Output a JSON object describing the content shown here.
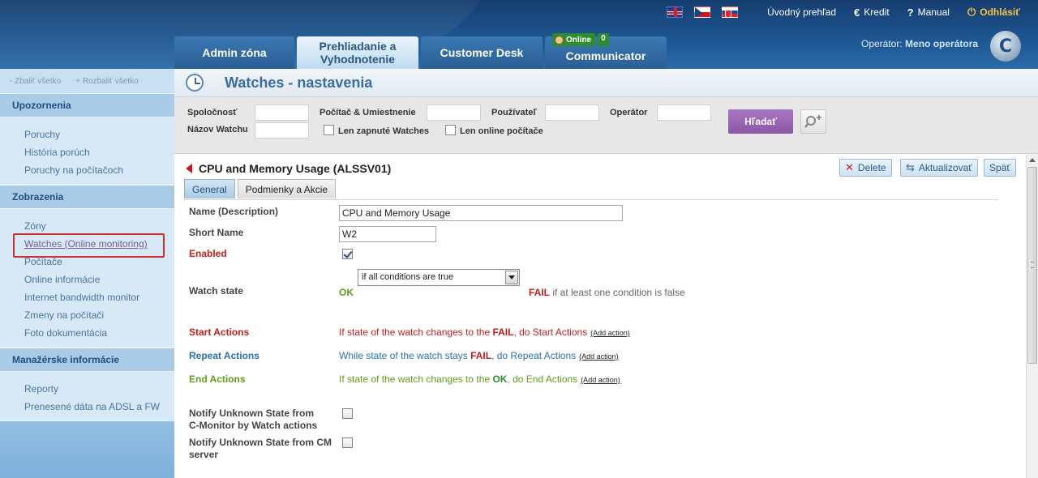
{
  "header": {
    "links": {
      "overview": "Úvodný prehľad",
      "credit": "Kredit",
      "manual": "Manual",
      "logout": "Odhlásiť"
    },
    "icons": {
      "credit": "€",
      "manual": "?",
      "logout": "⏻"
    },
    "tabs": {
      "admin": "Admin zóna",
      "review_line1": "Prehliadanie a",
      "review_line2": "Vyhodnotenie",
      "customer_desk": "Customer Desk",
      "communicator": "Communicator"
    },
    "online_badge": "Online",
    "online_count": "0",
    "operator_label": "Operátor:",
    "operator_name": "Meno operátora",
    "logo_letter": "C"
  },
  "sidebar": {
    "collapse_all": "- Zbaliť všetko",
    "expand_all": "+ Rozbaliť všetko",
    "sections": [
      {
        "title": "Upozornenia",
        "items": [
          "Poruchy",
          "História porúch",
          "Poruchy na počítačoch"
        ]
      },
      {
        "title": "Zobrazenia",
        "items": [
          "Zóny",
          "Watches (Online monitoring)",
          "Počítače",
          "Online informácie",
          "Internet bandwidth monitor",
          "Zmeny na počítači",
          "Foto dokumentácia"
        ]
      },
      {
        "title": "Manažérske informácie",
        "items": [
          "Reporty",
          "Prenesené dáta na ADSL a FW"
        ]
      }
    ]
  },
  "page": {
    "title": "Watches - nastavenia"
  },
  "filters": {
    "company": "Spoločnosť",
    "computer_location": "Počítač & Umiestnenie",
    "user": "Používateľ",
    "operator": "Operátor",
    "watch_name": "Názov Watchu",
    "only_enabled": "Len zapnuté Watches",
    "only_online": "Len online počítače",
    "search_button": "Hľadať"
  },
  "record": {
    "title": "CPU and Memory Usage (ALSSV01)",
    "buttons": {
      "delete": "Delete",
      "update": "Aktualizovať",
      "back": "Späť"
    },
    "tabs": {
      "general": "General",
      "conditions": "Podmienky a Akcie"
    },
    "fields": {
      "name_label": "Name (Description)",
      "name_value": "CPU and Memory Usage",
      "short_label": "Short Name",
      "short_value": "W2",
      "enabled_label": "Enabled",
      "enabled": true,
      "watch_state_label": "Watch state",
      "ok": "OK",
      "state_select": "if all conditions are true",
      "fail": "FAIL",
      "fail_text": "if at least one condition is false",
      "start_label": "Start Actions",
      "start_pre": "If state of the watch changes to the ",
      "start_fail": "FAIL",
      "start_post": ", do Start Actions",
      "repeat_label": "Repeat Actions",
      "repeat_pre": "While state of the watch stays ",
      "repeat_fail": "FAIL",
      "repeat_post": ", do Repeat Actions",
      "end_label": "End Actions",
      "end_pre": "If state of the watch changes to the ",
      "end_ok": "OK",
      "end_post": ", do End Actions",
      "add_action": "(Add action)",
      "notify_cm_line1": "Notify Unknown State from",
      "notify_cm_line2": "C-Monitor by Watch actions",
      "notify_server_line1": "Notify Unknown State from CM",
      "notify_server_line2": "server"
    }
  },
  "colors": {
    "accent_blue": "#3a6da3",
    "fail_red": "#c31d1d",
    "ok_green": "#5d9d1b",
    "search_purple": "#8b57a8"
  }
}
